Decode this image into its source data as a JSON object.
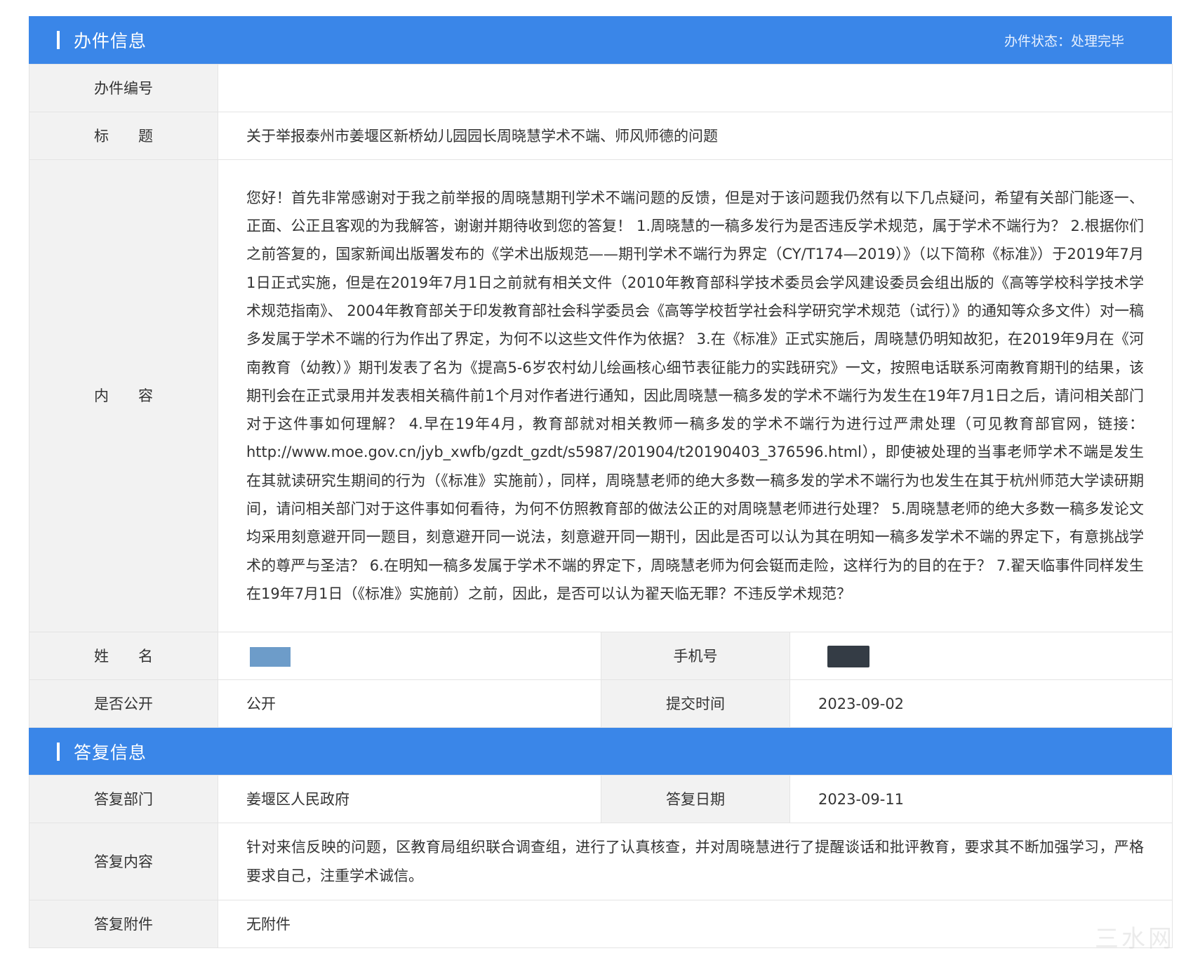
{
  "case_section": {
    "title": "办件信息",
    "status": "办件状态：处理完毕",
    "rows": {
      "case_no_label": "办件编号",
      "case_no_value": "",
      "title_label": "标　　题",
      "title_value": "关于举报泰州市姜堰区新桥幼儿园园长周晓慧学术不端、师风师德的问题",
      "content_label": "内　　容",
      "content_value": "您好！首先非常感谢对于我之前举报的周晓慧期刊学术不端问题的反馈，但是对于该问题我仍然有以下几点疑问，希望有关部门能逐一、正面、公正且客观的为我解答，谢谢并期待收到您的答复！ 1.周晓慧的一稿多发行为是否违反学术规范，属于学术不端行为？ 2.根据你们之前答复的，国家新闻出版署发布的《学术出版规范——期刊学术不端行为界定（CY/T174—2019）》（以下简称《标准》）于2019年7月1日正式实施，但是在2019年7月1日之前就有相关文件（2010年教育部科学技术委员会学风建设委员会组出版的《高等学校科学技术学术规范指南》、 2004年教育部关于印发教育部社会科学委员会《高等学校哲学社会科学研究学术规范（试行）》的通知等众多文件）对一稿多发属于学术不端的行为作出了界定，为何不以这些文件作为依据？ 3.在《标准》正式实施后，周晓慧仍明知故犯，在2019年9月在《河南教育（幼教）》期刊发表了名为《提高5-6岁农村幼儿绘画核心细节表征能力的实践研究》一文，按照电话联系河南教育期刊的结果，该期刊会在正式录用并发表相关稿件前1个月对作者进行通知，因此周晓慧一稿多发的学术不端行为发生在19年7月1日之后，请问相关部门对于这件事如何理解？ 4.早在19年4月，教育部就对相关教师一稿多发的学术不端行为进行过严肃处理（可见教育部官网，链接：http://www.moe.gov.cn/jyb_xwfb/gzdt_gzdt/s5987/201904/t20190403_376596.html），即使被处理的当事老师学术不端是发生在其就读研究生期间的行为（《标准》实施前），同样，周晓慧老师的绝大多数一稿多发的学术不端行为也发生在其于杭州师范大学读研期间，请问相关部门对于这件事如何看待，为何不仿照教育部的做法公正的对周晓慧老师进行处理？ 5.周晓慧老师的绝大多数一稿多发论文均采用刻意避开同一题目，刻意避开同一说法，刻意避开同一期刊，因此是否可以认为其在明知一稿多发学术不端的界定下，有意挑战学术的尊严与圣洁？ 6.在明知一稿多发属于学术不端的界定下，周晓慧老师为何会铤而走险，这样行为的目的在于？ 7.翟天临事件同样发生在19年7月1日（《标准》实施前）之前，因此，是否可以认为翟天临无罪？不违反学术规范？",
      "name_label": "姓　　名",
      "phone_label": "手机号",
      "public_label": "是否公开",
      "public_value": "公开",
      "submit_time_label": "提交时间",
      "submit_time_value": "2023-09-02"
    }
  },
  "reply_section": {
    "title": "答复信息",
    "rows": {
      "dept_label": "答复部门",
      "dept_value": "姜堰区人民政府",
      "date_label": "答复日期",
      "date_value": "2023-09-11",
      "content_label": "答复内容",
      "content_value": "针对来信反映的问题，区教育局组织联合调查组，进行了认真核查，并对周晓慧进行了提醒谈话和批评教育，要求其不断加强学习，严格要求自己，注重学术诚信。",
      "attachment_label": "答复附件",
      "attachment_value": "无附件"
    }
  },
  "colors": {
    "header_blue": "#3a86e8",
    "label_bg": "#f2f2f2",
    "border": "#e4e4e4",
    "redaction_blue": "#6d9cc9",
    "redaction_dark": "#343c45"
  },
  "watermark": "三水网"
}
